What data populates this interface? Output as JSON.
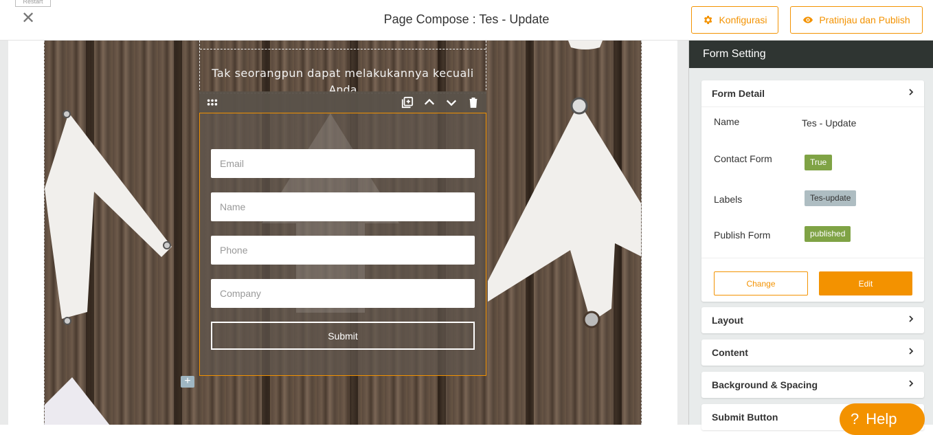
{
  "topbar": {
    "restart_label": "Restart",
    "close_glyph": "✕",
    "title": "Page Compose : Tes - Update",
    "config_label": "Konfigurasi",
    "publish_label": "Pratinjau dan Publish"
  },
  "canvas": {
    "quote_text": "Tak seorangpun dapat melakukannya kecuali",
    "quote_text_cont": "Anda",
    "form": {
      "fields": [
        {
          "placeholder": "Email"
        },
        {
          "placeholder": "Name"
        },
        {
          "placeholder": "Phone"
        },
        {
          "placeholder": "Company"
        }
      ],
      "submit_label": "Submit"
    },
    "add_glyph": "+"
  },
  "panel": {
    "title": "Form Setting",
    "form_detail": {
      "heading": "Form Detail",
      "rows": {
        "name_label": "Name",
        "name_value": "Tes - Update",
        "contact_label": "Contact Form",
        "contact_value": "True",
        "labels_label": "Labels",
        "labels_value": "Tes-update",
        "publish_label": "Publish Form",
        "publish_value": "published"
      },
      "change_label": "Change",
      "edit_label": "Edit"
    },
    "sections": [
      "Layout",
      "Content",
      "Background & Spacing",
      "Submit Button"
    ]
  },
  "help": {
    "glyph": "?",
    "label": "Help"
  },
  "colors": {
    "accent": "#f39200",
    "badge_green": "#7fa345",
    "badge_grey": "#aebdc2",
    "panel_header": "#2f3532"
  },
  "icons": [
    "gear-icon",
    "eye-icon",
    "close-icon",
    "drag-handle-icon",
    "duplicate-icon",
    "chevron-up-icon",
    "chevron-down-icon",
    "trash-icon",
    "chevron-right-icon",
    "plus-icon"
  ]
}
